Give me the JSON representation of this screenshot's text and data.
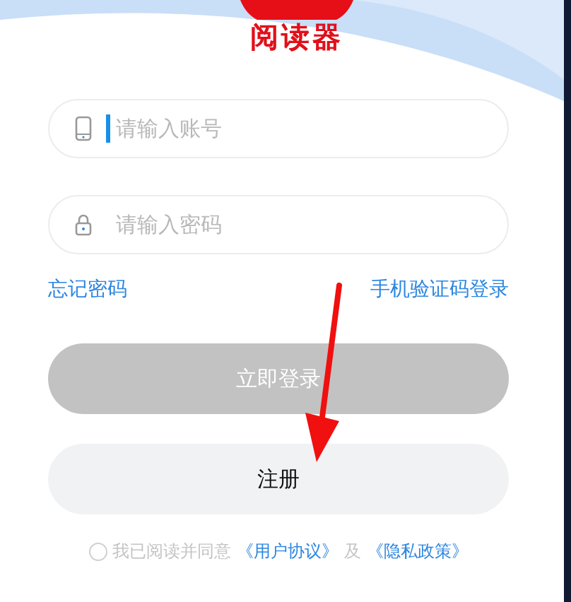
{
  "logo": {
    "text": "阅读器"
  },
  "fields": [
    {
      "kind": "phone",
      "placeholder": "请输入账号",
      "focused": true
    },
    {
      "kind": "lock",
      "placeholder": "请输入密码",
      "focused": false
    }
  ],
  "links": [
    "忘记密码",
    "手机验证码登录"
  ],
  "buttons": [
    {
      "label": "立即登录",
      "disabled": true
    },
    {
      "label": "注册",
      "disabled": false
    }
  ],
  "agreement": {
    "checked": false,
    "text": "我已阅读并同意",
    "links": [
      "《用户协议》",
      "《隐私政策》"
    ],
    "joiner": "及"
  }
}
